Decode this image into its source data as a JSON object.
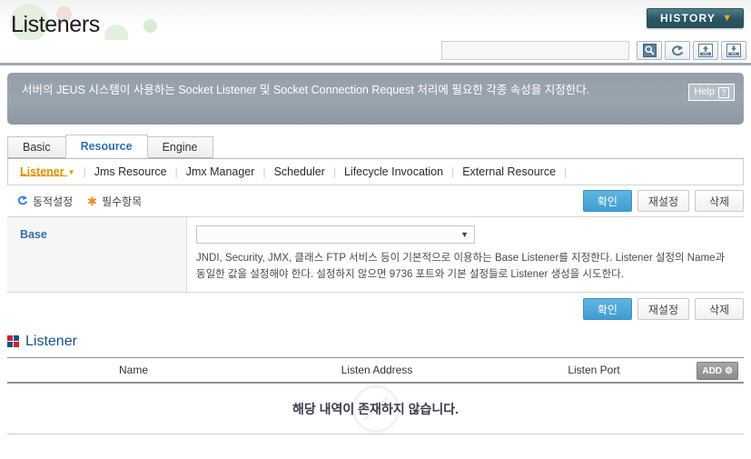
{
  "header": {
    "title": "Listeners",
    "history_label": "HISTORY",
    "history_caret": "▼"
  },
  "toolbar": {
    "search_value": "",
    "search_placeholder": "",
    "icons": [
      {
        "name": "search-icon",
        "glyph": "🔍"
      },
      {
        "name": "refresh-icon",
        "glyph": "↻"
      },
      {
        "name": "xml-upload-icon",
        "glyph": "XML"
      },
      {
        "name": "xml-download-icon",
        "glyph": "XML"
      }
    ]
  },
  "banner": {
    "text": "서버의 JEUS 시스템이 사용하는 Socket Listener 및 Socket Connection Request 처리에 필요한 각종 속성을 지정한다.",
    "help_label": "Help",
    "help_glyph": "?"
  },
  "tabs": [
    {
      "label": "Basic",
      "active": false
    },
    {
      "label": "Resource",
      "active": true
    },
    {
      "label": "Engine",
      "active": false
    }
  ],
  "subnav": [
    {
      "label": "Listener",
      "active": true,
      "caret": "▼"
    },
    {
      "label": "Jms Resource",
      "active": false
    },
    {
      "label": "Jmx Manager",
      "active": false
    },
    {
      "label": "Scheduler",
      "active": false
    },
    {
      "label": "Lifecycle Invocation",
      "active": false
    },
    {
      "label": "External Resource",
      "active": false
    }
  ],
  "legend": {
    "dynamic_label": "동적설정",
    "dynamic_icon": "↺",
    "required_label": "필수항목",
    "required_icon": "✱"
  },
  "buttons": {
    "confirm": "확인",
    "reset": "재설정",
    "delete": "삭제"
  },
  "form": {
    "base_label": "Base",
    "base_value": "",
    "base_caret": "▼",
    "base_desc": "JNDI, Security, JMX, 클래스 FTP 서비스 등이 기본적으로 이용하는 Base Listener를 지정한다. Listener 설정의 Name과 동일한 값을 설정해야 한다. 설정하지 않으면 9736 포트와 기본 설정들로 Listener 생성을 시도한다."
  },
  "section": {
    "title": "Listener",
    "columns": {
      "name": "Name",
      "listen_address": "Listen Address",
      "listen_port": "Listen Port"
    },
    "add_label": "ADD",
    "add_icon": "⚙",
    "rows": [],
    "empty_message": "해당 내역이 존재하지 않습니다."
  },
  "colors": {
    "accent_blue": "#16508f",
    "active_tab": "#2f6fa8",
    "subnav_active": "#e09200",
    "primary_button": "#3f9ed1",
    "history_button": "#2c5561",
    "banner_bg": "#9aa4af"
  }
}
